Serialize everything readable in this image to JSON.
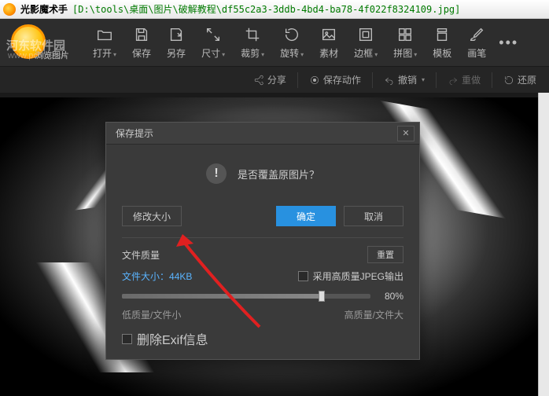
{
  "titlebar": {
    "app_name": "光影魔术手",
    "path": "[D:\\tools\\桌面\\图片\\破解教程\\df55c2a3-3ddb-4bd4-ba78-4f022f8324109.jpg]"
  },
  "watermark": {
    "line1": "河东软件园",
    "line2": "www.pc5t59.cn"
  },
  "toolbar": {
    "browse": "浏览图片",
    "open": "打开",
    "save": "保存",
    "saveas": "另存",
    "size": "尺寸",
    "crop": "裁剪",
    "rotate": "旋转",
    "material": "素材",
    "border": "边框",
    "collage": "拼图",
    "template": "模板",
    "brush": "画笔"
  },
  "subtoolbar": {
    "share": "分享",
    "save_action": "保存动作",
    "undo": "撤销",
    "redo": "重做",
    "restore": "还原"
  },
  "dialog": {
    "title": "保存提示",
    "message": "是否覆盖原图片？",
    "btn_resize": "修改大小",
    "btn_ok": "确定",
    "btn_cancel": "取消",
    "quality_label": "文件质量",
    "btn_reset": "重置",
    "filesize_label": "文件大小：",
    "filesize_value": "44KB",
    "hq_jpeg": "采用高质量JPEG输出",
    "slider_value": "80%",
    "low_quality": "低质量/文件小",
    "high_quality": "高质量/文件大",
    "delete_exif": "删除Exif信息"
  }
}
